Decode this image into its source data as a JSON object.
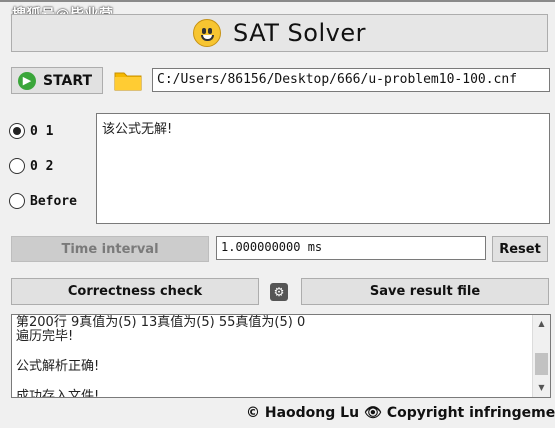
{
  "watermark": "搜狐号@毕业营",
  "header": {
    "title": "SAT Solver",
    "icon": "smiley-icon"
  },
  "toolbar": {
    "start_label": "START",
    "file_path": "C:/Users/86156/Desktop/666/u-problem10-100.cnf"
  },
  "options": [
    {
      "label": "0 1",
      "selected": true
    },
    {
      "label": "0 2",
      "selected": false
    },
    {
      "label": "Before",
      "selected": false
    }
  ],
  "result": {
    "text": "该公式无解!"
  },
  "timing": {
    "button_label": "Time interval",
    "value": "1.000000000 ms",
    "reset_label": "Reset"
  },
  "actions": {
    "check_label": "Correctness check",
    "save_label": "Save result file"
  },
  "log": {
    "lines": [
      "第200行 9真值为(5) 13真值为(5) 55真值为(5) 0",
      "遍历完毕!",
      "",
      "公式解析正确!",
      "",
      "成功存入文件!"
    ]
  },
  "footer": {
    "author": "© Haodong Lu",
    "notice": "Copyright infringement"
  },
  "colors": {
    "accent_green": "#3aa63a",
    "smiley": "#f7c531",
    "folder": "#f5b800"
  }
}
